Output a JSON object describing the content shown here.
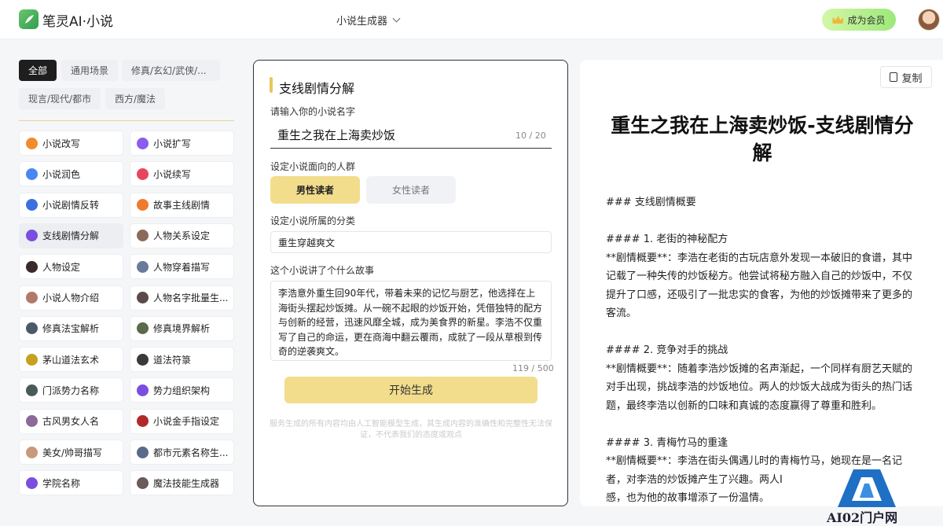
{
  "header": {
    "brand": "笔灵AI·小说",
    "generator_dropdown": "小说生成器",
    "member_button": "成为会员"
  },
  "filters": [
    "全部",
    "通用场景",
    "修真/玄幻/武侠/...",
    "现言/现代/都市",
    "西方/魔法"
  ],
  "tools": [
    {
      "label": "小说改写",
      "icon": "rewrite-icon",
      "color": "#f28a2e"
    },
    {
      "label": "小说扩写",
      "icon": "expand-icon",
      "color": "#8a5cf0"
    },
    {
      "label": "小说润色",
      "icon": "polish-icon",
      "color": "#4a86f0"
    },
    {
      "label": "小说续写",
      "icon": "continue-icon",
      "color": "#e8455c"
    },
    {
      "label": "小说剧情反转",
      "icon": "reverse-icon",
      "color": "#3b6fe0"
    },
    {
      "label": "故事主线剧情",
      "icon": "mainline-icon",
      "color": "#f07a2e"
    },
    {
      "label": "支线剧情分解",
      "icon": "subplot-icon",
      "color": "#7a4ee0"
    },
    {
      "label": "人物关系设定",
      "icon": "relation-avatar-icon",
      "color": "#8a6a5a"
    },
    {
      "label": "人物设定",
      "icon": "character-avatar-icon",
      "color": "#3a2a2a"
    },
    {
      "label": "人物穿着描写",
      "icon": "outfit-avatar-icon",
      "color": "#6a7a9a"
    },
    {
      "label": "小说人物介绍",
      "icon": "intro-avatar-icon",
      "color": "#b07a6a"
    },
    {
      "label": "人物名字批量生...",
      "icon": "names-avatar-icon",
      "color": "#5a4a4a"
    },
    {
      "label": "修真法宝解析",
      "icon": "treasure-avatar-icon",
      "color": "#4a5a6a"
    },
    {
      "label": "修真境界解析",
      "icon": "realm-avatar-icon",
      "color": "#5a6a4a"
    },
    {
      "label": "茅山道法玄术",
      "icon": "taoist-avatar-icon",
      "color": "#c8a020"
    },
    {
      "label": "道法符箓",
      "icon": "talisman-avatar-icon",
      "color": "#3a3a3a"
    },
    {
      "label": "门派势力名称",
      "icon": "sect-avatar-icon",
      "color": "#4a5a5a"
    },
    {
      "label": "势力组织架构",
      "icon": "org-icon",
      "color": "#7a4ee0"
    },
    {
      "label": "古风男女人名",
      "icon": "ancient-avatar-icon",
      "color": "#8a6a9a"
    },
    {
      "label": "小说金手指设定",
      "icon": "cheat-avatar-icon",
      "color": "#b02a2a"
    },
    {
      "label": "美女/帅哥描写",
      "icon": "beauty-avatar-icon",
      "color": "#c89a7a"
    },
    {
      "label": "都市元素名称生...",
      "icon": "city-avatar-icon",
      "color": "#5a6a8a"
    },
    {
      "label": "学院名称",
      "icon": "academy-icon",
      "color": "#7a4ee0"
    },
    {
      "label": "魔法技能生成器",
      "icon": "magic-avatar-icon",
      "color": "#6a5a5a"
    }
  ],
  "form": {
    "title": "支线剧情分解",
    "name_label": "请输入你的小说名字",
    "name_value": "重生之我在上海卖炒饭",
    "name_counter": "10 / 20",
    "audience_label": "设定小说面向的人群",
    "audience_selected": "男性读者",
    "audience_other": "女性读者",
    "category_label": "设定小说所属的分类",
    "category_value": "重生穿越爽文",
    "story_label": "这个小说讲了个什么故事",
    "story_value": "李浩意外重生回90年代，带着未来的记忆与厨艺，他选择在上海街头摆起炒饭摊。从一碗不起眼的炒饭开始，凭借独特的配方与创新的经营，迅速风靡全城，成为美食界的新星。李浩不仅重写了自己的命运，更在商海中翻云覆雨，成就了一段从草根到传奇的逆袭爽文。",
    "story_counter": "119 / 500",
    "start_button": "开始生成",
    "disclaimer": "服务生成的所有内容均由人工智能模型生成，其生成内容的准确性和完整性无法保证，不代表我们的态度或观点"
  },
  "result": {
    "copy_button": "复制",
    "title": "重生之我在上海卖炒饭-支线剧情分解",
    "body": "### 支线剧情概要\n\n#### 1. 老街的神秘配方\n**剧情概要**：李浩在老街的古玩店意外发现一本破旧的食谱，其中记载了一种失传的炒饭秘方。他尝试将秘方融入自己的炒饭中，不仅提升了口感，还吸引了一批忠实的食客，为他的炒饭摊带来了更多的客流。\n\n#### 2. 竞争对手的挑战\n**剧情概要**：随着李浩炒饭摊的名声渐起，一个同样有厨艺天赋的对手出现，挑战李浩的炒饭地位。两人的炒饭大战成为街头的热门话题，最终李浩以创新的口味和真诚的态度赢得了尊重和胜利。\n\n#### 3. 青梅竹马的重逢\n**剧情概要**：李浩在街头偶遇儿时的青梅竹马，她现在是一名记者，对李浩的炒饭摊产生了兴趣。两人I\n感，也为他的故事增添了一份温情。"
  },
  "watermark": {
    "text": "AI02门户网"
  }
}
